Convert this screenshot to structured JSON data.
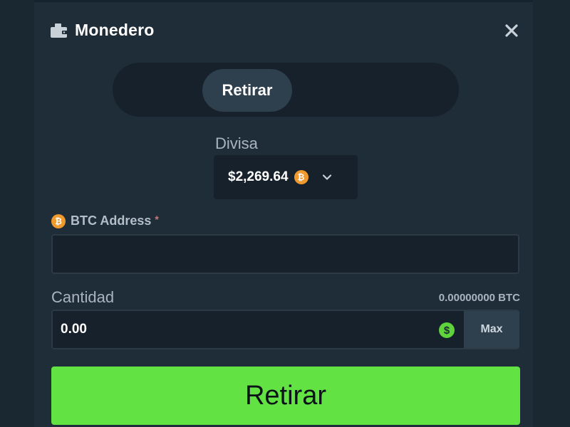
{
  "header": {
    "title": "Monedero",
    "wallet_icon": "wallet-icon",
    "close_icon": "close-icon"
  },
  "tabs": [
    {
      "label": "Retirar",
      "active": true
    }
  ],
  "currency": {
    "label": "Divisa",
    "selected_value": "$2,269.64",
    "coin_icon": "bitcoin-icon",
    "dropdown_icon": "chevron-down-icon"
  },
  "address": {
    "label": "BTC Address",
    "required_mark": "*",
    "value": "",
    "coin_icon": "bitcoin-icon"
  },
  "amount": {
    "label": "Cantidad",
    "balance": "0.00000000 BTC",
    "value": "0.00",
    "currency_icon": "dollar-icon",
    "max_label": "Max"
  },
  "submit": {
    "label": "Retirar"
  },
  "colors": {
    "background": "#1f2d38",
    "input_bg": "#16212b",
    "accent_green": "#63e343",
    "bitcoin_orange": "#f09a2e"
  }
}
